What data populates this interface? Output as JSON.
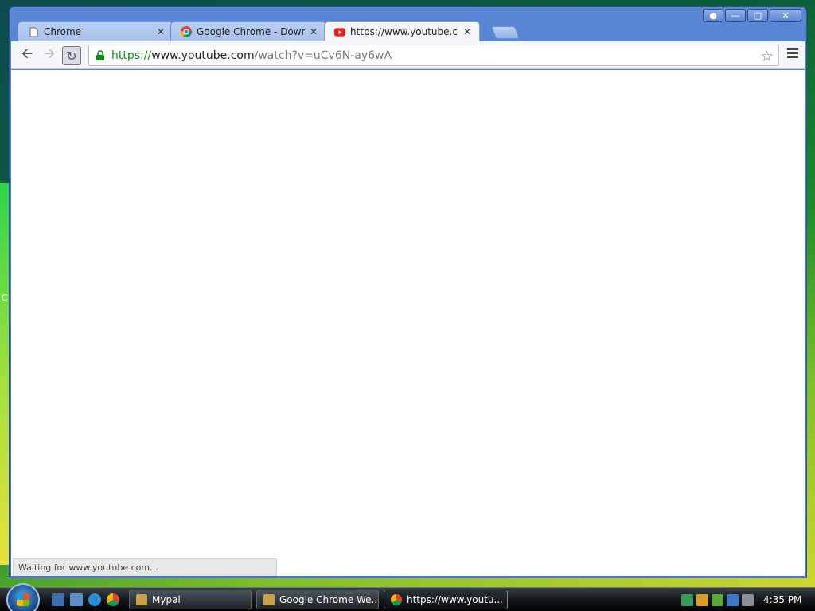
{
  "browser": {
    "tabs": [
      {
        "title": "Chrome",
        "icon": "page-icon"
      },
      {
        "title": "Google Chrome - Downlo",
        "icon": "chrome-logo-icon"
      },
      {
        "title": "https://www.youtube.con",
        "icon": "youtube-icon",
        "active": true
      }
    ],
    "address": {
      "scheme": "https://",
      "host": "www.youtube.com",
      "path": "/watch?v=uCv6N-ay6wA"
    },
    "status": "Waiting for www.youtube.com..."
  },
  "taskbar": {
    "tasks": [
      {
        "label": "Mypal",
        "icon": "mypal-icon"
      },
      {
        "label": "Google Chrome We...",
        "icon": "mypal-icon"
      },
      {
        "label": "https://www.youtu...",
        "icon": "chrome-logo-icon",
        "active": true
      }
    ],
    "clock": "4:35 PM"
  },
  "colors": {
    "accent": "#4f7cd0",
    "secure_url": "#0b8a17"
  }
}
